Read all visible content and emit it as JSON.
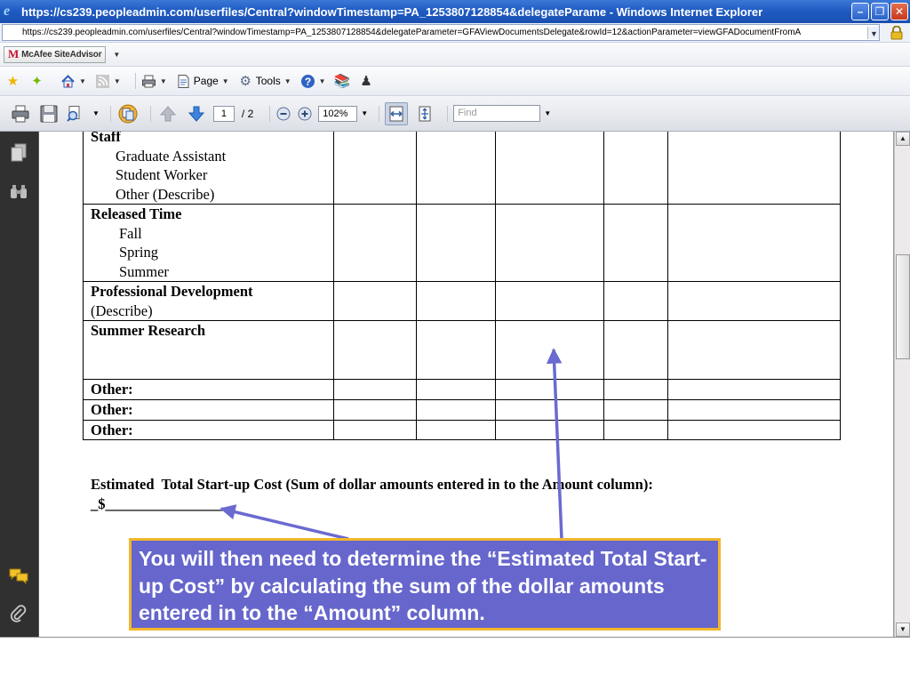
{
  "window": {
    "title": "https://cs239.peopleadmin.com/userfiles/Central?windowTimestamp=PA_1253807128854&delegateParame - Windows Internet Explorer",
    "minimize_icon": "minimize-icon",
    "maximize_icon": "restore-icon",
    "close_icon": "close-icon"
  },
  "address_bar": {
    "url": "https://cs239.peopleadmin.com/userfiles/Central?windowTimestamp=PA_1253807128854&delegateParameter=GFAViewDocumentsDelegate&rowId=12&actionParameter=viewGFADocumentFromA"
  },
  "mcafee": {
    "label": "McAfee SiteAdvisor",
    "logo_letter": "M"
  },
  "command_bar": {
    "page_label": "Page",
    "tools_label": "Tools"
  },
  "pdf_toolbar": {
    "current_page": "1",
    "page_total": "/ 2",
    "zoom": "102%",
    "find_placeholder": "Find"
  },
  "document": {
    "rows": [
      {
        "heading": "Staff",
        "items": [
          "Graduate Assistant",
          "Student Worker",
          "Other (Describe)"
        ]
      },
      {
        "heading": "Released Time",
        "items": [
          "Fall",
          "Spring",
          "Summer"
        ]
      },
      {
        "heading": "Professional Development",
        "items": [
          "(Describe)"
        ]
      },
      {
        "heading": "Summer Research",
        "items": []
      },
      {
        "heading": "Other:",
        "items": []
      },
      {
        "heading": "Other:",
        "items": []
      },
      {
        "heading": "Other:",
        "items": []
      }
    ],
    "estimate_label": "Estimated  Total Start-up Cost (Sum of dollar amounts entered in to the Amount column):",
    "estimate_line": "_$________________"
  },
  "callout": {
    "text": "You will then need to determine the “Estimated  Total Start-up Cost” by calculating the sum of the dollar amounts entered in to the “Amount” column.",
    "background": "#6666cc",
    "border": "#f1b72b"
  }
}
